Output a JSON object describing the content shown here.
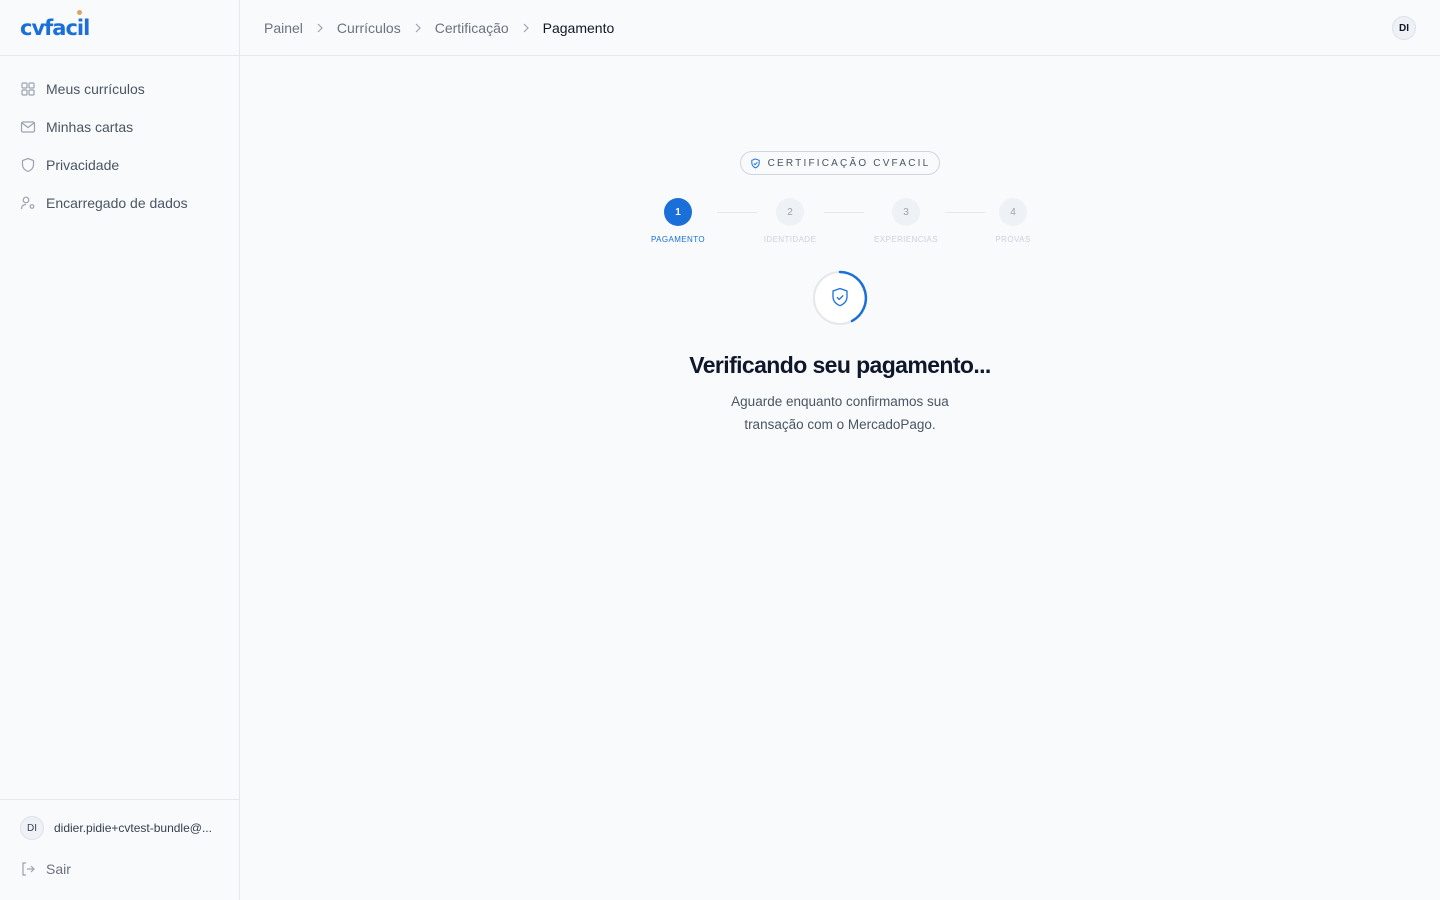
{
  "brand": {
    "logo_text": "cvfacil",
    "accent_color": "#1a6fd8",
    "dot_color": "#e0a458"
  },
  "sidebar": {
    "items": [
      {
        "label": "Meus currículos",
        "icon": "grid-icon"
      },
      {
        "label": "Minhas cartas",
        "icon": "mail-icon"
      },
      {
        "label": "Privacidade",
        "icon": "shield-icon"
      },
      {
        "label": "Encarregado de dados",
        "icon": "user-gear-icon"
      }
    ],
    "user": {
      "initials": "DI",
      "email": "didier.pidie+cvtest-bundle@..."
    },
    "logout_label": "Sair"
  },
  "header": {
    "breadcrumbs": [
      "Painel",
      "Currículos",
      "Certificação",
      "Pagamento"
    ],
    "avatar_initials": "DI"
  },
  "main": {
    "badge_label": "CERTIFICAÇÃO CVFACIL",
    "steps": [
      {
        "number": "1",
        "label": "PAGAMENTO",
        "active": true
      },
      {
        "number": "2",
        "label": "IDENTIDADE",
        "active": false
      },
      {
        "number": "3",
        "label": "EXPERIENCIAS",
        "active": false
      },
      {
        "number": "4",
        "label": "PROVAS",
        "active": false
      }
    ],
    "title": "Verificando seu pagamento...",
    "subtitle_line1": "Aguarde enquanto confirmamos sua",
    "subtitle_line2": "transação com o MercadoPago."
  }
}
